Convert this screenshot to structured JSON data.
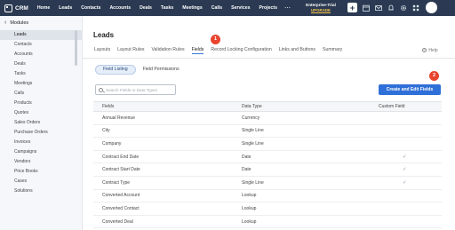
{
  "app": {
    "brand": "CRM",
    "nav": [
      "Home",
      "Leads",
      "Contacts",
      "Accounts",
      "Deals",
      "Tasks",
      "Meetings",
      "Calls",
      "Services",
      "Projects"
    ],
    "more": "⋯",
    "trial_label": "Enterprise-Trial",
    "upgrade_label": "UPGRADE"
  },
  "sidebar": {
    "title": "Modules",
    "back": "‹",
    "items": [
      "Leads",
      "Contacts",
      "Accounts",
      "Deals",
      "Tasks",
      "Meetings",
      "Calls",
      "Products",
      "Quotes",
      "Sales Orders",
      "Purchase Orders",
      "Invoices",
      "Campaigns",
      "Vendors",
      "Price Books",
      "Cases",
      "Solutions"
    ],
    "active": "Leads"
  },
  "main": {
    "title": "Leads",
    "tabs": [
      "Layouts",
      "Layout Rules",
      "Validation Rules",
      "Fields",
      "Record Locking Configuration",
      "Links and Buttons",
      "Summary"
    ],
    "active_tab": "Fields",
    "help": "Help",
    "help_icon": "?",
    "segments": [
      "Field Listing",
      "Field Permissions"
    ],
    "active_segment": "Field Listing",
    "search_placeholder": "Search Fields or Data Types",
    "create_button": "Create and Edit Fields",
    "badges": [
      "1",
      "2"
    ]
  },
  "table": {
    "headers": [
      "Fields",
      "Data Type",
      "Custom Field"
    ],
    "rows": [
      {
        "field": "Annual Revenue",
        "type": "Currency",
        "custom": ""
      },
      {
        "field": "City",
        "type": "Single Line",
        "custom": ""
      },
      {
        "field": "Company",
        "type": "Single Line",
        "custom": ""
      },
      {
        "field": "Contract End Date",
        "type": "Date",
        "custom": "✓"
      },
      {
        "field": "Contract Start Date",
        "type": "Date",
        "custom": "✓"
      },
      {
        "field": "Contract Type",
        "type": "Single Line",
        "custom": "✓"
      },
      {
        "field": "Converted Account",
        "type": "Lookup",
        "custom": ""
      },
      {
        "field": "Converted Contact",
        "type": "Lookup",
        "custom": ""
      },
      {
        "field": "Converted Deal",
        "type": "Lookup",
        "custom": ""
      }
    ]
  },
  "colors": {
    "nav_bg": "#2b3a52",
    "accent": "#2f6fd8",
    "badge": "#e8442e",
    "upgrade": "#f6c34a"
  },
  "icons": [
    "crm-logo-icon",
    "plus-icon",
    "calendar-icon",
    "mail-icon",
    "bell-icon",
    "settings-icon",
    "apps-icon",
    "avatar-icon",
    "search-icon",
    "help-icon",
    "check-icon"
  ]
}
